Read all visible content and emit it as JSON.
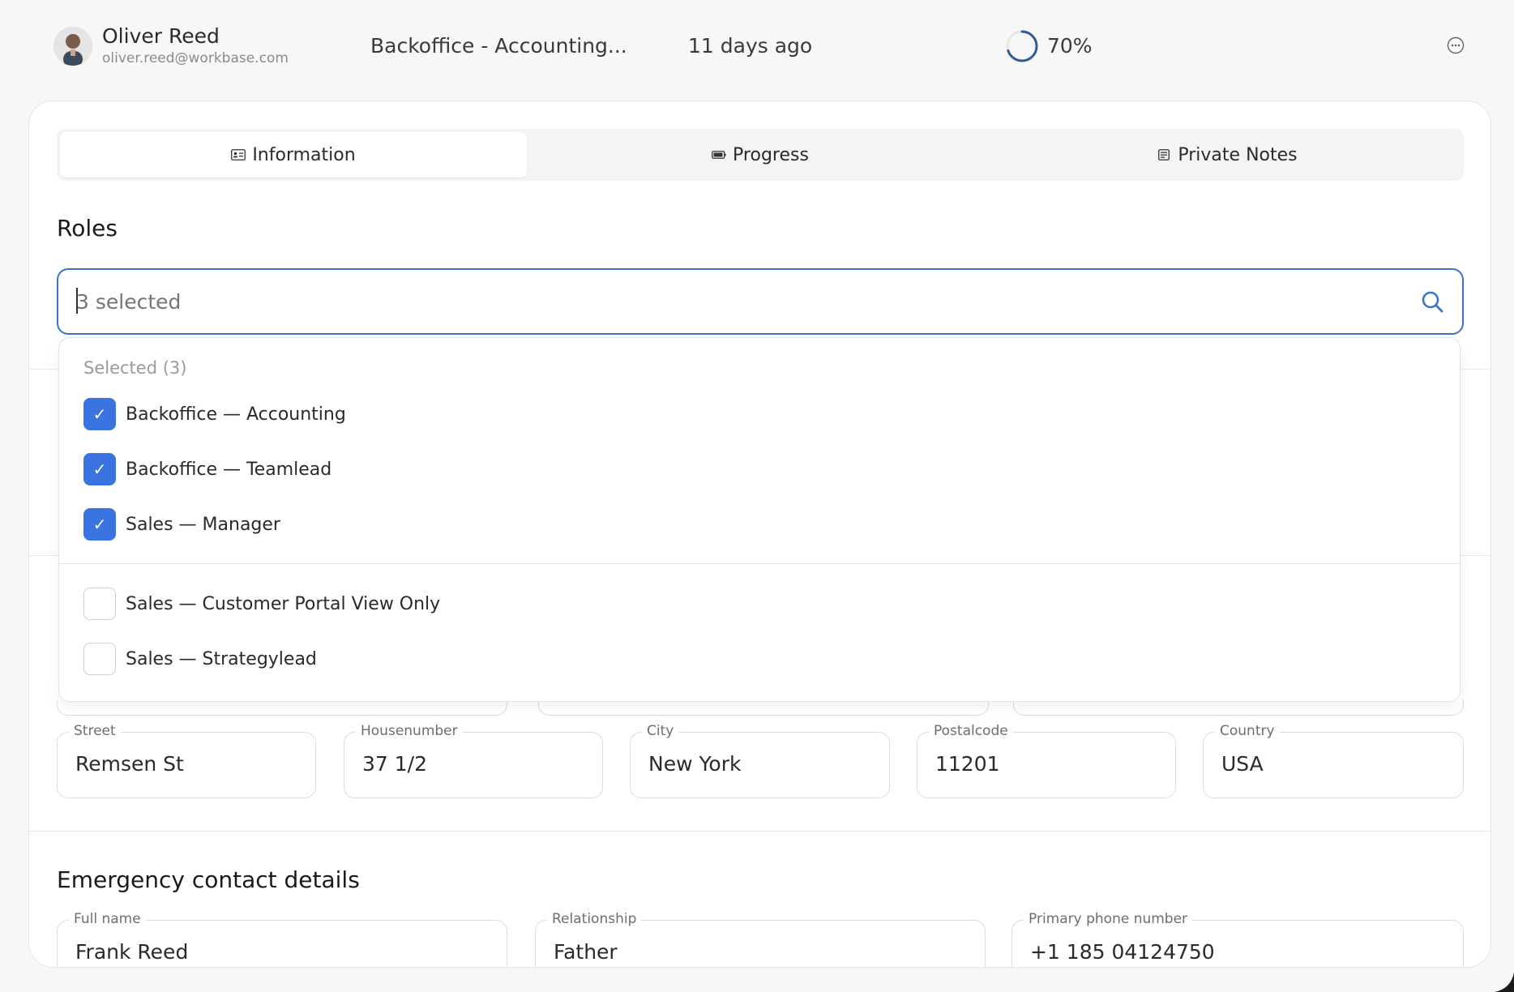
{
  "header": {
    "user_name": "Oliver Reed",
    "user_email": "oliver.reed@workbase.com",
    "role": "Backoffice - Accounting...",
    "time": "11 days ago",
    "progress_text": "70%",
    "progress_value": 0.7
  },
  "tabs": [
    {
      "label": "Information",
      "icon": "id-card-icon"
    },
    {
      "label": "Progress",
      "icon": "battery-icon"
    },
    {
      "label": "Private Notes",
      "icon": "note-icon"
    }
  ],
  "roles": {
    "title": "Roles",
    "search_placeholder": "3 selected",
    "dropdown": {
      "header": "Selected (3)",
      "selected": [
        {
          "label": "Backoffice — Accounting",
          "checked": true
        },
        {
          "label": "Backoffice — Teamlead",
          "checked": true
        },
        {
          "label": "Sales — Manager",
          "checked": true
        }
      ],
      "unselected": [
        {
          "label": "Sales — Customer Portal View Only",
          "checked": false
        },
        {
          "label": "Sales — Strategylead",
          "checked": false
        }
      ]
    }
  },
  "address": {
    "street": {
      "label": "Street",
      "value": "Remsen St"
    },
    "housenumber": {
      "label": "Housenumber",
      "value": "37 1/2"
    },
    "city": {
      "label": "City",
      "value": "New York"
    },
    "postalcode": {
      "label": "Postalcode",
      "value": "11201"
    },
    "country": {
      "label": "Country",
      "value": "USA"
    }
  },
  "emergency": {
    "title": "Emergency contact details",
    "full_name": {
      "label": "Full name",
      "value": "Frank Reed"
    },
    "relationship": {
      "label": "Relationship",
      "value": "Father"
    },
    "phone": {
      "label": "Primary phone number",
      "value": "+1 185 04124750"
    }
  },
  "colors": {
    "accent": "#3b73e0",
    "focus_border": "#3b73c8",
    "progress_ring": "#2f5b9c"
  }
}
